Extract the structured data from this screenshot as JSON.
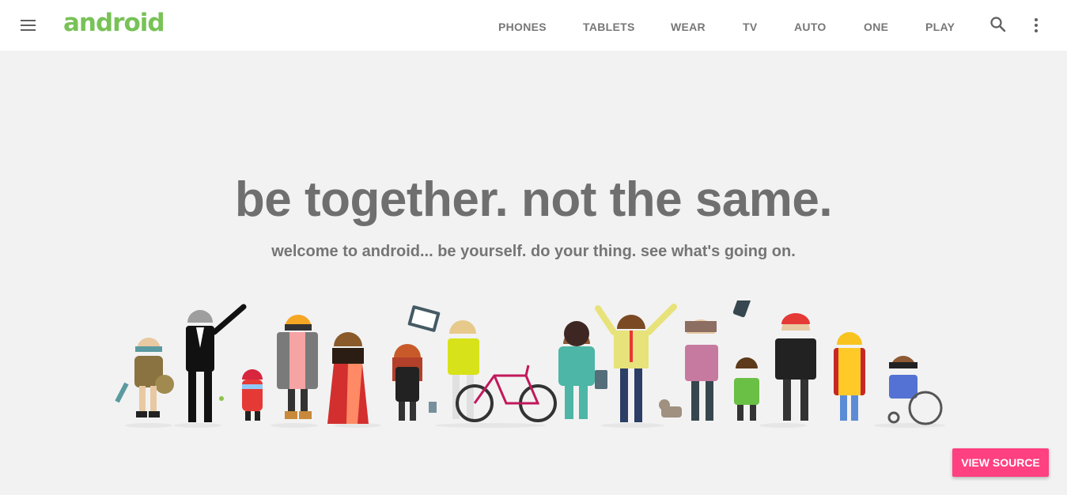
{
  "header": {
    "logo_text": "android",
    "nav": [
      {
        "label": "PHONES"
      },
      {
        "label": "TABLETS"
      },
      {
        "label": "WEAR"
      },
      {
        "label": "TV"
      },
      {
        "label": "AUTO"
      },
      {
        "label": "ONE"
      },
      {
        "label": "PLAY"
      }
    ],
    "icons": {
      "menu": "hamburger-menu-icon",
      "search": "search-icon",
      "more": "more-vert-icon"
    }
  },
  "hero": {
    "title": "be together. not the same.",
    "subtitle": "welcome to android... be yourself. do your thing. see what's going on."
  },
  "actions": {
    "view_source_label": "VIEW SOURCE"
  },
  "colors": {
    "brand_green": "#78c257",
    "accent_pink": "#ff4081",
    "background": "#f2f2f2",
    "nav_text": "#777777",
    "hero_text": "#6f6f6f"
  }
}
